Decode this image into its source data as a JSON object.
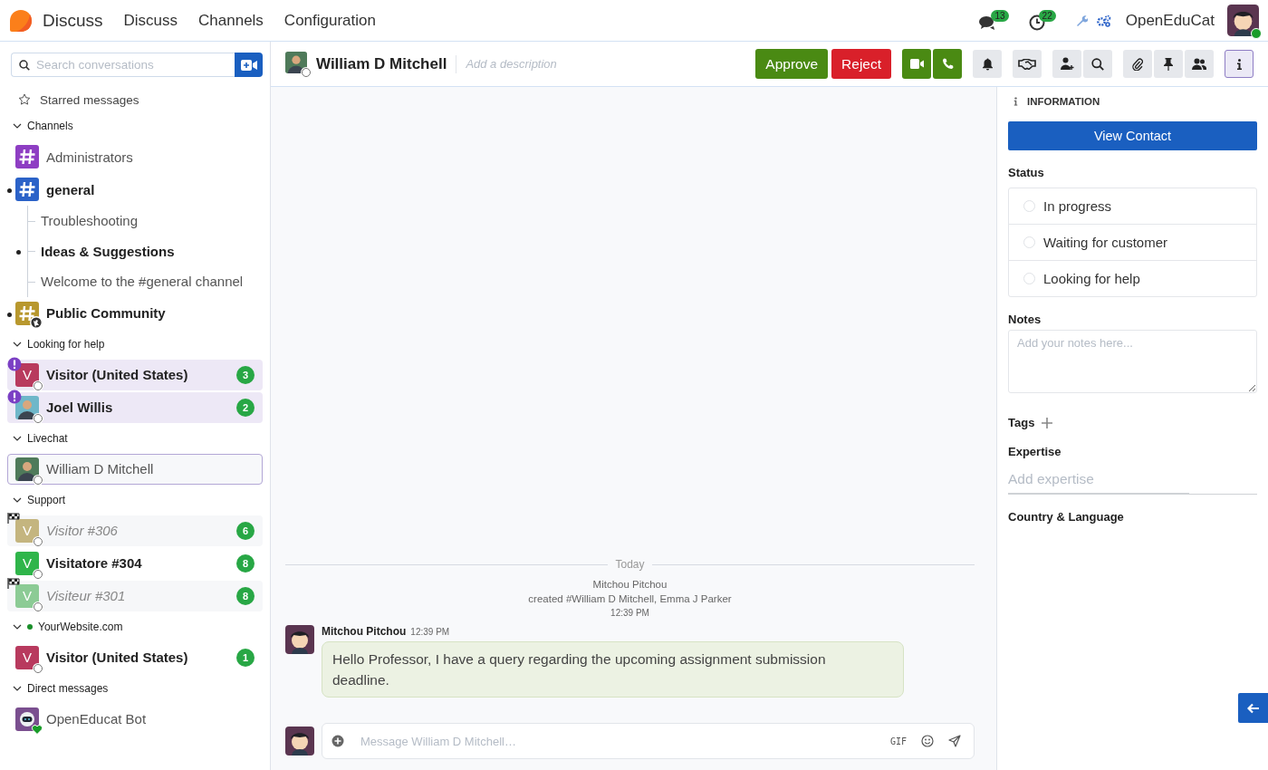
{
  "navbar": {
    "app_name": "Discuss",
    "menu": [
      "Discuss",
      "Channels",
      "Configuration"
    ],
    "chat_count": "13",
    "activity_count": "22",
    "company": "OpenEduCat"
  },
  "sidebar": {
    "search_placeholder": "Search conversations",
    "starred": "Starred messages",
    "categories": [
      {
        "title": "Channels",
        "expanded": true,
        "items": [
          {
            "kind": "channel",
            "name": "Administrators",
            "color": "#8e3ec3",
            "unread": false,
            "selected": false
          },
          {
            "kind": "channel",
            "name": "general",
            "color": "#2b62c8",
            "unread": true,
            "selected": false,
            "children": [
              {
                "name": "Troubleshooting",
                "unread": false,
                "selected": false
              },
              {
                "name": "Ideas & Suggestions",
                "unread": true,
                "selected": false
              },
              {
                "name": "Welcome to the #general channel",
                "unread": false,
                "selected": false
              }
            ]
          },
          {
            "kind": "public_channel",
            "name": "Public Community",
            "color": "#b8982e",
            "unread": true,
            "selected": false
          }
        ]
      },
      {
        "title": "Looking for help",
        "expanded": true,
        "items": [
          {
            "kind": "visitor",
            "initial": "V",
            "name": "Visitor (United States)",
            "color": "#b83a5e",
            "unread": true,
            "urgent": true,
            "badge": "3",
            "selected": false
          },
          {
            "kind": "person",
            "name": "Joel Willis",
            "color": "#6fb7c9",
            "unread": true,
            "urgent": true,
            "badge": "2",
            "selected": false
          }
        ]
      },
      {
        "title": "Livechat",
        "expanded": true,
        "items": [
          {
            "kind": "person",
            "name": "William D Mitchell",
            "color": "#4f7a5a",
            "unread": false,
            "selected": true
          }
        ]
      },
      {
        "title": "Support",
        "expanded": true,
        "items": [
          {
            "kind": "visitor",
            "initial": "V",
            "name": "Visitor #306",
            "color": "#c4b57f",
            "unread": false,
            "flagged": true,
            "badge": "6",
            "selected": false
          },
          {
            "kind": "visitor",
            "initial": "V",
            "name": "Visitatore #304",
            "color": "#2fb54a",
            "unread": true,
            "badge": "8",
            "selected": false
          },
          {
            "kind": "visitor",
            "initial": "V",
            "name": "Visiteur #301",
            "color": "#8ccb95",
            "unread": false,
            "flagged": true,
            "badge": "8",
            "selected": false
          }
        ]
      },
      {
        "title": "YourWebsite.com",
        "expanded": true,
        "color": "#1a8f2a",
        "items": [
          {
            "kind": "visitor",
            "initial": "V",
            "name": "Visitor (United States)",
            "color": "#b83a5e",
            "unread": true,
            "badge": "1",
            "selected": false
          }
        ]
      },
      {
        "title": "Direct messages",
        "expanded": true,
        "items": [
          {
            "kind": "bot",
            "name": "OpenEducat Bot",
            "color": "#7a4f8f",
            "unread": false,
            "selected": false
          }
        ]
      }
    ]
  },
  "header": {
    "name": "William D Mitchell",
    "description_placeholder": "Add a description",
    "actions": [
      {
        "kind": "approve",
        "label": "Approve"
      },
      {
        "kind": "reject",
        "label": "Reject"
      }
    ],
    "tool_groups": [
      [
        {
          "kind": "video",
          "selected": false
        },
        {
          "kind": "phone",
          "selected": false
        }
      ],
      [
        {
          "kind": "bell",
          "selected": false
        }
      ],
      [
        {
          "kind": "handshake",
          "selected": false
        }
      ],
      [
        {
          "kind": "add-user",
          "selected": false
        },
        {
          "kind": "search",
          "selected": false
        }
      ],
      [
        {
          "kind": "paperclip",
          "selected": false
        },
        {
          "kind": "pin",
          "selected": false
        },
        {
          "kind": "members",
          "selected": false
        }
      ],
      [
        {
          "kind": "info",
          "selected": true
        }
      ]
    ]
  },
  "chat": {
    "date": "Today",
    "notification": {
      "author": "Mitchou Pitchou",
      "text": "created #William D Mitchell, Emma J Parker",
      "time": "12:39 PM"
    },
    "messages": [
      {
        "author": "Mitchou Pitchou",
        "time": "12:39 PM",
        "body": "Hello Professor, I have a query regarding the upcoming assignment submission deadline."
      }
    ],
    "composer": {
      "placeholder": "Message William D Mitchell…",
      "gif_label": "GIF"
    }
  },
  "info": {
    "heading": "INFORMATION",
    "view_contact": "View Contact",
    "status_label": "Status",
    "statuses": [
      {
        "label": "In progress",
        "selected": false
      },
      {
        "label": "Waiting for customer",
        "selected": false
      },
      {
        "label": "Looking for help",
        "selected": false
      }
    ],
    "notes_label": "Notes",
    "notes_placeholder": "Add your notes here...",
    "tags_label": "Tags",
    "expertise_label": "Expertise",
    "expertise_placeholder": "Add expertise",
    "country_label": "Country & Language"
  }
}
